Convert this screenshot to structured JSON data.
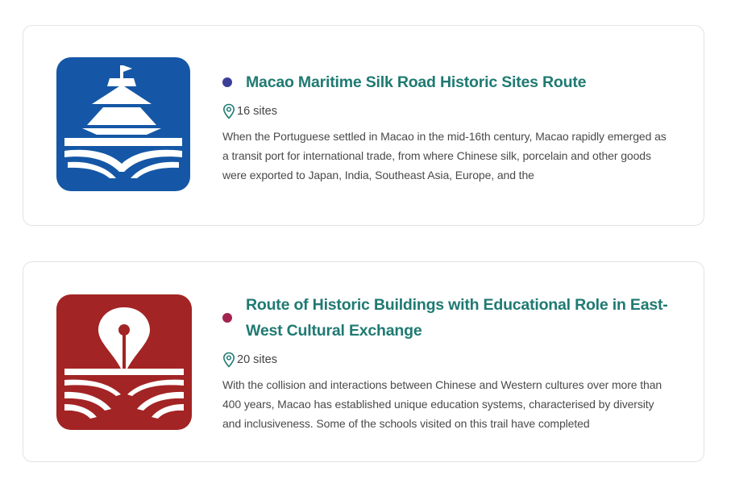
{
  "routes": [
    {
      "title": "Macao Maritime Silk Road Historic Sites Route",
      "sites": "16 sites",
      "description": "When the Portuguese settled in Macao in the mid-16th century, Macao rapidly emerged as a transit port for international trade, from where Chinese silk, porcelain and other goods were exported to Japan, India, Southeast Asia, Europe, and the",
      "dot_color": "#3b3f98",
      "logo_color": "#1557a6",
      "logo_icon": "ship-book-icon"
    },
    {
      "title": "Route of Historic Buildings with Educational Role in East-West Cultural Exchange",
      "sites": "20 sites",
      "description": "With the collision and interactions between Chinese and Western cultures over more than 400 years, Macao has established unique education systems, characterised by diversity and inclusiveness. Some of the schools visited on this trail have completed",
      "dot_color": "#a3234f",
      "logo_color": "#a32424",
      "logo_icon": "pen-book-icon"
    }
  ],
  "colors": {
    "title": "#1f7a72",
    "text": "#4a4a4a",
    "card_border": "#e3e3e3"
  }
}
